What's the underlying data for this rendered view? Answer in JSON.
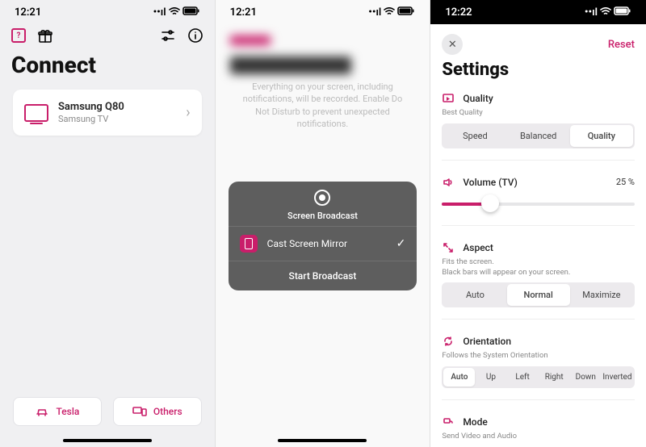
{
  "screen1": {
    "status_time": "12:21",
    "title": "Connect",
    "device": {
      "name": "Samsung Q80",
      "sub": "Samsung TV"
    },
    "buttons": {
      "tesla": "Tesla",
      "others": "Others"
    }
  },
  "screen2": {
    "status_time": "12:21",
    "notice": "Everything on your screen, including notifications, will be recorded. Enable Do Not Disturb to prevent unexpected notifications.",
    "sheet": {
      "title": "Screen Broadcast",
      "app_name": "Cast Screen Mirror",
      "start": "Start Broadcast"
    }
  },
  "screen3": {
    "status_time": "12:22",
    "reset": "Reset",
    "title": "Settings",
    "quality": {
      "label": "Quality",
      "sub": "Best Quality",
      "opts": {
        "speed": "Speed",
        "balanced": "Balanced",
        "quality": "Quality"
      }
    },
    "volume": {
      "label": "Volume (TV)",
      "value": "25 %"
    },
    "aspect": {
      "label": "Aspect",
      "sub": "Fits the screen.\nBlack bars will appear on your screen.",
      "opts": {
        "auto": "Auto",
        "normal": "Normal",
        "maximize": "Maximize"
      }
    },
    "orientation": {
      "label": "Orientation",
      "sub": "Follows the System Orientation",
      "opts": {
        "auto": "Auto",
        "up": "Up",
        "left": "Left",
        "right": "Right",
        "down": "Down",
        "inverted": "Inverted"
      }
    },
    "mode": {
      "label": "Mode",
      "sub": "Send Video and Audio"
    }
  }
}
